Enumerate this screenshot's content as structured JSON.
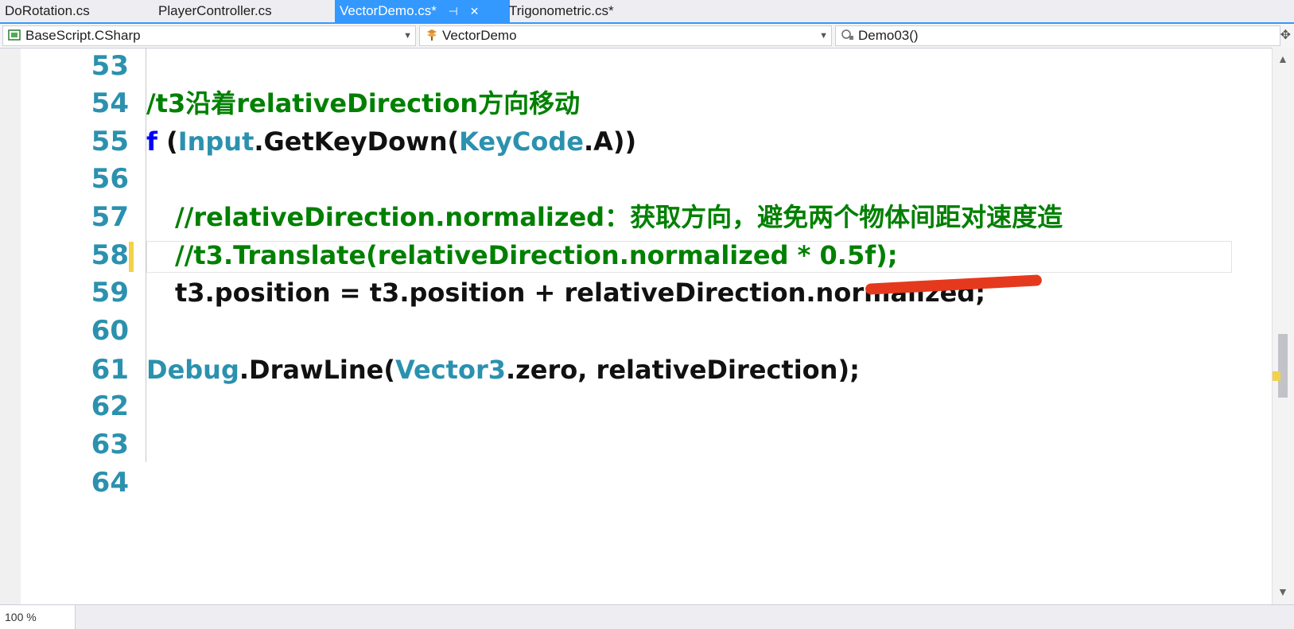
{
  "tabs": [
    {
      "label": "DoRotation.cs",
      "active": false
    },
    {
      "label": "PlayerController.cs",
      "active": false
    },
    {
      "label": "VectorDemo.cs*",
      "active": true,
      "pin": "⊣",
      "close": "✕"
    },
    {
      "label": "Trigonometric.cs*",
      "active": false
    }
  ],
  "nav": {
    "project": "BaseScript.CSharp",
    "class": "VectorDemo",
    "member": "Demo03()"
  },
  "icons": [
    "project-icon",
    "class-icon",
    "method-icon",
    "pin-icon",
    "close-icon",
    "split-icon",
    "scroll-up-icon",
    "scroll-down-icon"
  ],
  "colors": {
    "tab_active": "#3399ff",
    "comment": "#008000",
    "keyword": "#0000ff",
    "type": "#2b91af",
    "line_number": "#2b91af",
    "annotation": "#e5391e",
    "change_marker": "#f2d24a"
  },
  "lines": {
    "l53": {
      "num": "53"
    },
    "l54": {
      "num": "54",
      "comment": "/t3沿着relativeDirection方向移动"
    },
    "l55": {
      "num": "55",
      "kw": "f",
      "p1": " (",
      "t1": "Input",
      "p2": ".GetKeyDown(",
      "t2": "KeyCode",
      "p3": ".A))"
    },
    "l56": {
      "num": "56"
    },
    "l57": {
      "num": "57",
      "comment": "//relativeDirection.normalized：获取方向，避免两个物体间距对速度造"
    },
    "l58": {
      "num": "58",
      "comment": "//t3.Translate(relativeDirection.normalized * 0.5f);"
    },
    "l59": {
      "num": "59",
      "code": "t3.position = t3.position + relativeDirection.normalized;"
    },
    "l60": {
      "num": "60"
    },
    "l61": {
      "num": "61",
      "t1": "Debug",
      "p1": ".DrawLine(",
      "t2": "Vector3",
      "p2": ".zero, relativeDirection);"
    },
    "l62": {
      "num": "62"
    },
    "l63": {
      "num": "63"
    },
    "l64": {
      "num": "64"
    }
  },
  "status": {
    "zoom": "100 %"
  }
}
